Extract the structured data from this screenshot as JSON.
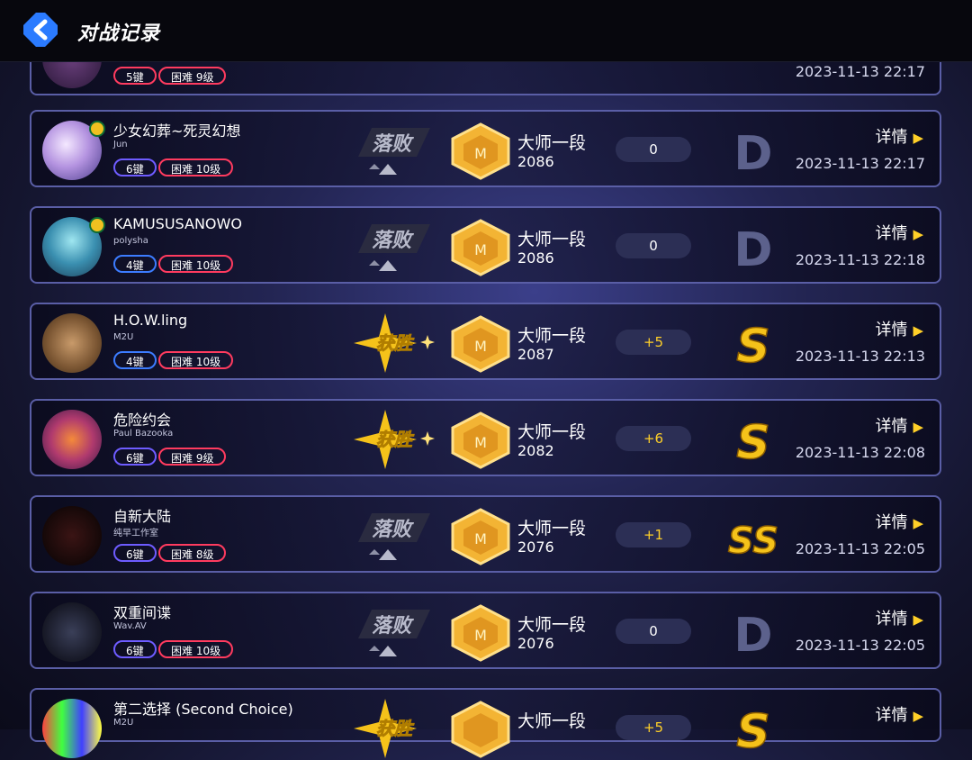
{
  "header": {
    "title": "对战记录"
  },
  "partial_row": {
    "keys": "5键",
    "difficulty": "困难 9级",
    "time": "2023-11-13 22:17"
  },
  "records": [
    {
      "song": "少女幻葬~死灵幻想",
      "artist": "Jun",
      "keys": "6键",
      "difficulty": "困难 10级",
      "result": "落败",
      "rank": "大师一段",
      "score": "2086",
      "delta": "0",
      "grade": "D",
      "details": "详情",
      "time": "2023-11-13 22:17"
    },
    {
      "song": "KAMUSUSANOWO",
      "artist": "polysha",
      "keys": "4键",
      "difficulty": "困难 10级",
      "result": "落败",
      "rank": "大师一段",
      "score": "2086",
      "delta": "0",
      "grade": "D",
      "details": "详情",
      "time": "2023-11-13 22:18"
    },
    {
      "song": "H.O.W.ling",
      "artist": "M2U",
      "keys": "4键",
      "difficulty": "困难 10级",
      "result": "获胜",
      "rank": "大师一段",
      "score": "2087",
      "delta": "+5",
      "grade": "S",
      "details": "详情",
      "time": "2023-11-13 22:13"
    },
    {
      "song": "危险约会",
      "artist": "Paul Bazooka",
      "keys": "6键",
      "difficulty": "困难 9级",
      "result": "获胜",
      "rank": "大师一段",
      "score": "2082",
      "delta": "+6",
      "grade": "S",
      "details": "详情",
      "time": "2023-11-13 22:08"
    },
    {
      "song": "自新大陆",
      "artist": "纯早工作室",
      "keys": "6键",
      "difficulty": "困难 8级",
      "result": "落败",
      "rank": "大师一段",
      "score": "2076",
      "delta": "+1",
      "grade": "SS",
      "details": "详情",
      "time": "2023-11-13 22:05"
    },
    {
      "song": "双重间谍",
      "artist": "Wav.AV",
      "keys": "6键",
      "difficulty": "困难 10级",
      "result": "落败",
      "rank": "大师一段",
      "score": "2076",
      "delta": "0",
      "grade": "D",
      "details": "详情",
      "time": "2023-11-13 22:05"
    },
    {
      "song": "第二选择 (Second Choice)",
      "artist": "M2U",
      "keys": "",
      "difficulty": "",
      "result": "获胜",
      "rank": "大师一段",
      "score": "",
      "delta": "+5",
      "grade": "S",
      "details": "详情",
      "time": ""
    }
  ],
  "colors": {
    "accent_gold": "#ffd028",
    "win_gold": "#f5c21a",
    "lose_gray": "#9a9cb0",
    "keys_border": "#6e5cff",
    "diff_border": "#ff3b5f"
  },
  "icons": {
    "back": "back-arrow-icon",
    "details": "play-triangle-icon"
  }
}
